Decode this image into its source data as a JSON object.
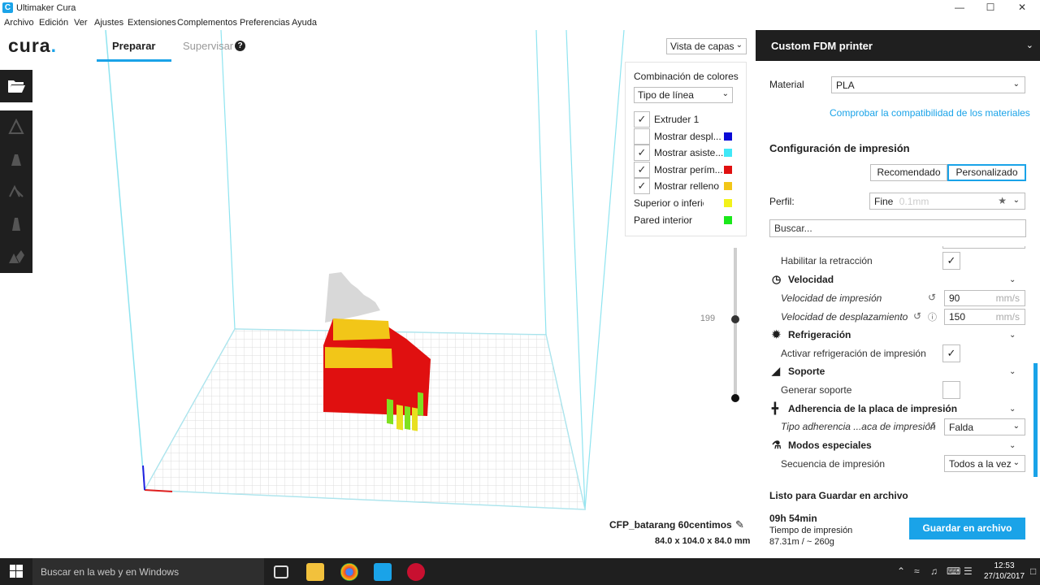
{
  "window": {
    "title": "Ultimaker Cura",
    "minimize": "—",
    "maximize": "☐",
    "close": "✕"
  },
  "menu": [
    "Archivo",
    "Edición",
    "Ver",
    "Ajustes",
    "Extensiones",
    "Complementos",
    "Preferencias",
    "Ayuda"
  ],
  "logo": {
    "text": "cura",
    "dot": "."
  },
  "tabs": {
    "prepare": "Preparar",
    "monitor": "Supervisar",
    "help": "?"
  },
  "view_select": {
    "value": "Vista de capas"
  },
  "layer_panel": {
    "color_scheme_label": "Combinación de colores",
    "color_scheme_value": "Tipo de línea",
    "rows": [
      {
        "label": "Extruder 1",
        "checked": true,
        "color": ""
      },
      {
        "label": "Mostrar despl...",
        "checked": false,
        "color": "#0a0ad6"
      },
      {
        "label": "Mostrar asiste...",
        "checked": true,
        "color": "#40e8f7"
      },
      {
        "label": "Mostrar perím...",
        "checked": true,
        "color": "#e01010"
      },
      {
        "label": "Mostrar relleno",
        "checked": true,
        "color": "#f2c618"
      }
    ],
    "legend": [
      {
        "label": "Superior o inferior",
        "color": "#f2f21a"
      },
      {
        "label": "Pared interior",
        "color": "#1ae81a"
      }
    ]
  },
  "layer_slider": {
    "current": "199",
    "max": "216"
  },
  "object": {
    "name": "CFP_batarang 60centimos",
    "dims": "84.0 x 104.0 x 84.0 mm"
  },
  "sidebar": {
    "printer": "Custom FDM printer",
    "material_label": "Material",
    "material_value": "PLA",
    "compat_link": "Comprobar la compatibilidad de los materiales",
    "print_setup_title": "Configuración de impresión",
    "recommended": "Recomendado",
    "custom": "Personalizado",
    "profile_label": "Perfil:",
    "profile_value": "Fine",
    "profile_suffix": "0.1mm",
    "search_placeholder": "Buscar...",
    "settings": {
      "retraction": "Habilitar la retracción",
      "speed_section": "Velocidad",
      "print_speed": "Velocidad de impresión",
      "print_speed_value": "90",
      "travel_speed": "Velocidad de desplazamiento",
      "travel_speed_value": "150",
      "unit": "mm/s",
      "cooling_section": "Refrigeración",
      "enable_cooling": "Activar refrigeración de impresión",
      "support_section": "Soporte",
      "generate_support": "Generar soporte",
      "adhesion_section": "Adherencia de la placa de impresión",
      "adhesion_type": "Tipo adherencia ...aca de impresión",
      "adhesion_value": "Falda",
      "special_section": "Modos especiales",
      "print_sequence": "Secuencia de impresión",
      "print_sequence_value": "Todos a la vez"
    },
    "ready_title": "Listo para Guardar en archivo",
    "time": "09h 54min",
    "time_label": "Tiempo de impresión",
    "material_usage": "87.31m / ~ 260g",
    "save_button": "Guardar en archivo"
  },
  "taskbar": {
    "search": "Buscar en la web y en Windows",
    "time": "12:53",
    "date": "27/10/2017"
  },
  "colors": {
    "accent": "#1aa3e8",
    "dark": "#1f1f1f",
    "perimeter": "#e01010",
    "infill": "#f2c618"
  }
}
